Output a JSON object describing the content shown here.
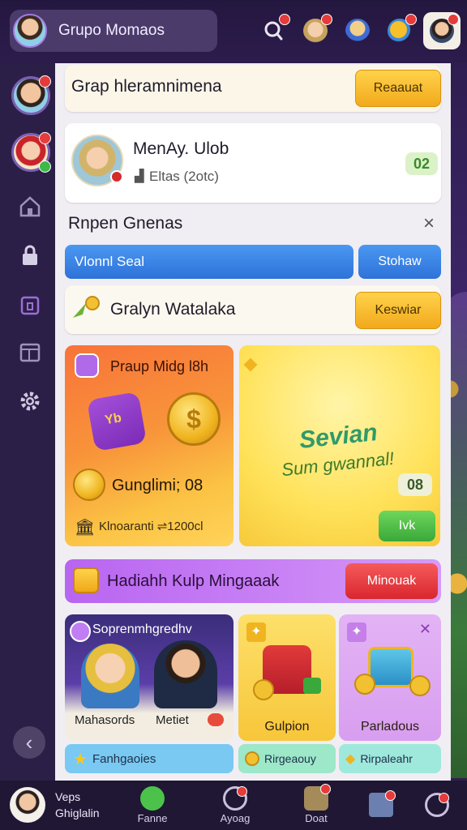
{
  "header": {
    "group_title": "Grupo Momaos"
  },
  "main": {
    "group_bar": {
      "title": "Grap hleramnimena",
      "button": "Reaauat"
    },
    "member_card": {
      "name": "MenAy. Ulob",
      "sub": "Eltas (2otc)",
      "badge": "02"
    },
    "section": {
      "title": "Rnpen Gnenas",
      "close": "×"
    },
    "search_row": {
      "value": "Vlonnl Seal",
      "button": "Stohaw"
    },
    "reward_row": {
      "title": "Gralyn Watalaka",
      "button": "Keswiar"
    },
    "promo_left": {
      "title": "Praup Midg l8h",
      "amount_title": "Gunglimi; 08",
      "footer": "Klnoaranti ⇌1200cl",
      "bag_text": "Yb"
    },
    "promo_right": {
      "line1": "Sevian",
      "line2": "Sum gwannal!",
      "badge": "08",
      "button": "Ivk"
    },
    "purple_banner": {
      "title": "Hadiahh Kulp Mingaaak",
      "button": "Minouak"
    },
    "tiles": [
      {
        "title": "Soprenmhgredhv",
        "label_left": "Mahasords",
        "label_right": "Metiet"
      },
      {
        "label": "Gulpion"
      },
      {
        "label": "Parladous"
      }
    ],
    "chips": [
      {
        "label": "Fanhgaoies"
      },
      {
        "label": "Rirgeaouy"
      },
      {
        "label": "Rirpaleahr"
      }
    ]
  },
  "bottom_nav": {
    "profile_line1": "Veps",
    "profile_line2": "Ghiglalin",
    "items": [
      {
        "label": "Fanne"
      },
      {
        "label": "Ayoag"
      },
      {
        "label": "Doat"
      },
      {
        "label": ""
      },
      {
        "label": ""
      }
    ]
  }
}
